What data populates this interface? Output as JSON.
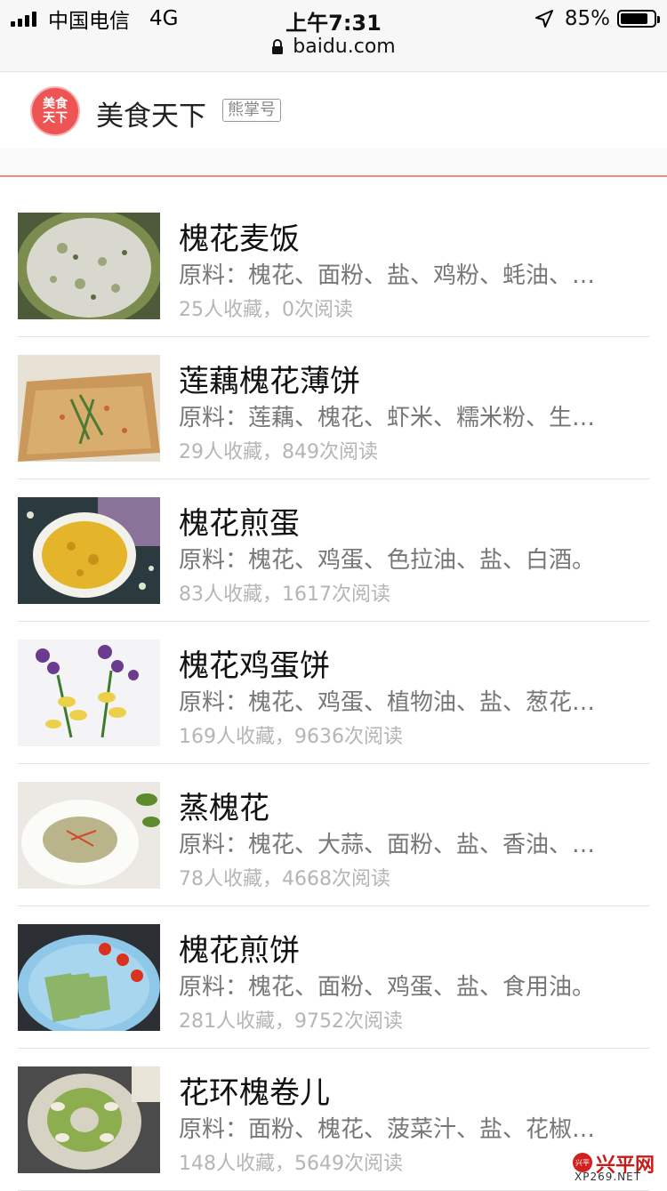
{
  "status_bar": {
    "carrier": "中国电信",
    "network": "4G",
    "time": "上午7:31",
    "battery": "85%",
    "battery_level": 0.85,
    "url": "baidu.com"
  },
  "account": {
    "logo_text_line1": "美食",
    "logo_text_line2": "天下",
    "name": "美食天下",
    "badge": "熊掌号"
  },
  "recipes": [
    {
      "title": "槐花麦饭",
      "ingredients": "原料：槐花、面粉、盐、鸡粉、蚝油、…",
      "stats": "25人收藏，0次阅读"
    },
    {
      "title": "莲藕槐花薄饼",
      "ingredients": "原料：莲藕、槐花、虾米、糯米粉、生…",
      "stats": "29人收藏，849次阅读"
    },
    {
      "title": "槐花煎蛋",
      "ingredients": "原料：槐花、鸡蛋、色拉油、盐、白酒。",
      "stats": "83人收藏，1617次阅读"
    },
    {
      "title": "槐花鸡蛋饼",
      "ingredients": "原料：槐花、鸡蛋、植物油、盐、葱花…",
      "stats": "169人收藏，9636次阅读"
    },
    {
      "title": "蒸槐花",
      "ingredients": "原料：槐花、大蒜、面粉、盐、香油、…",
      "stats": "78人收藏，4668次阅读"
    },
    {
      "title": "槐花煎饼",
      "ingredients": "原料：槐花、面粉、鸡蛋、盐、食用油。",
      "stats": "281人收藏，9752次阅读"
    },
    {
      "title": "花环槐卷儿",
      "ingredients": "原料：面粉、槐花、菠菜汁、盐、花椒…",
      "stats": "148人收藏，5649次阅读"
    }
  ],
  "watermark": {
    "cn": "兴平网",
    "en": "XP269.NET",
    "badge": "兴平"
  }
}
